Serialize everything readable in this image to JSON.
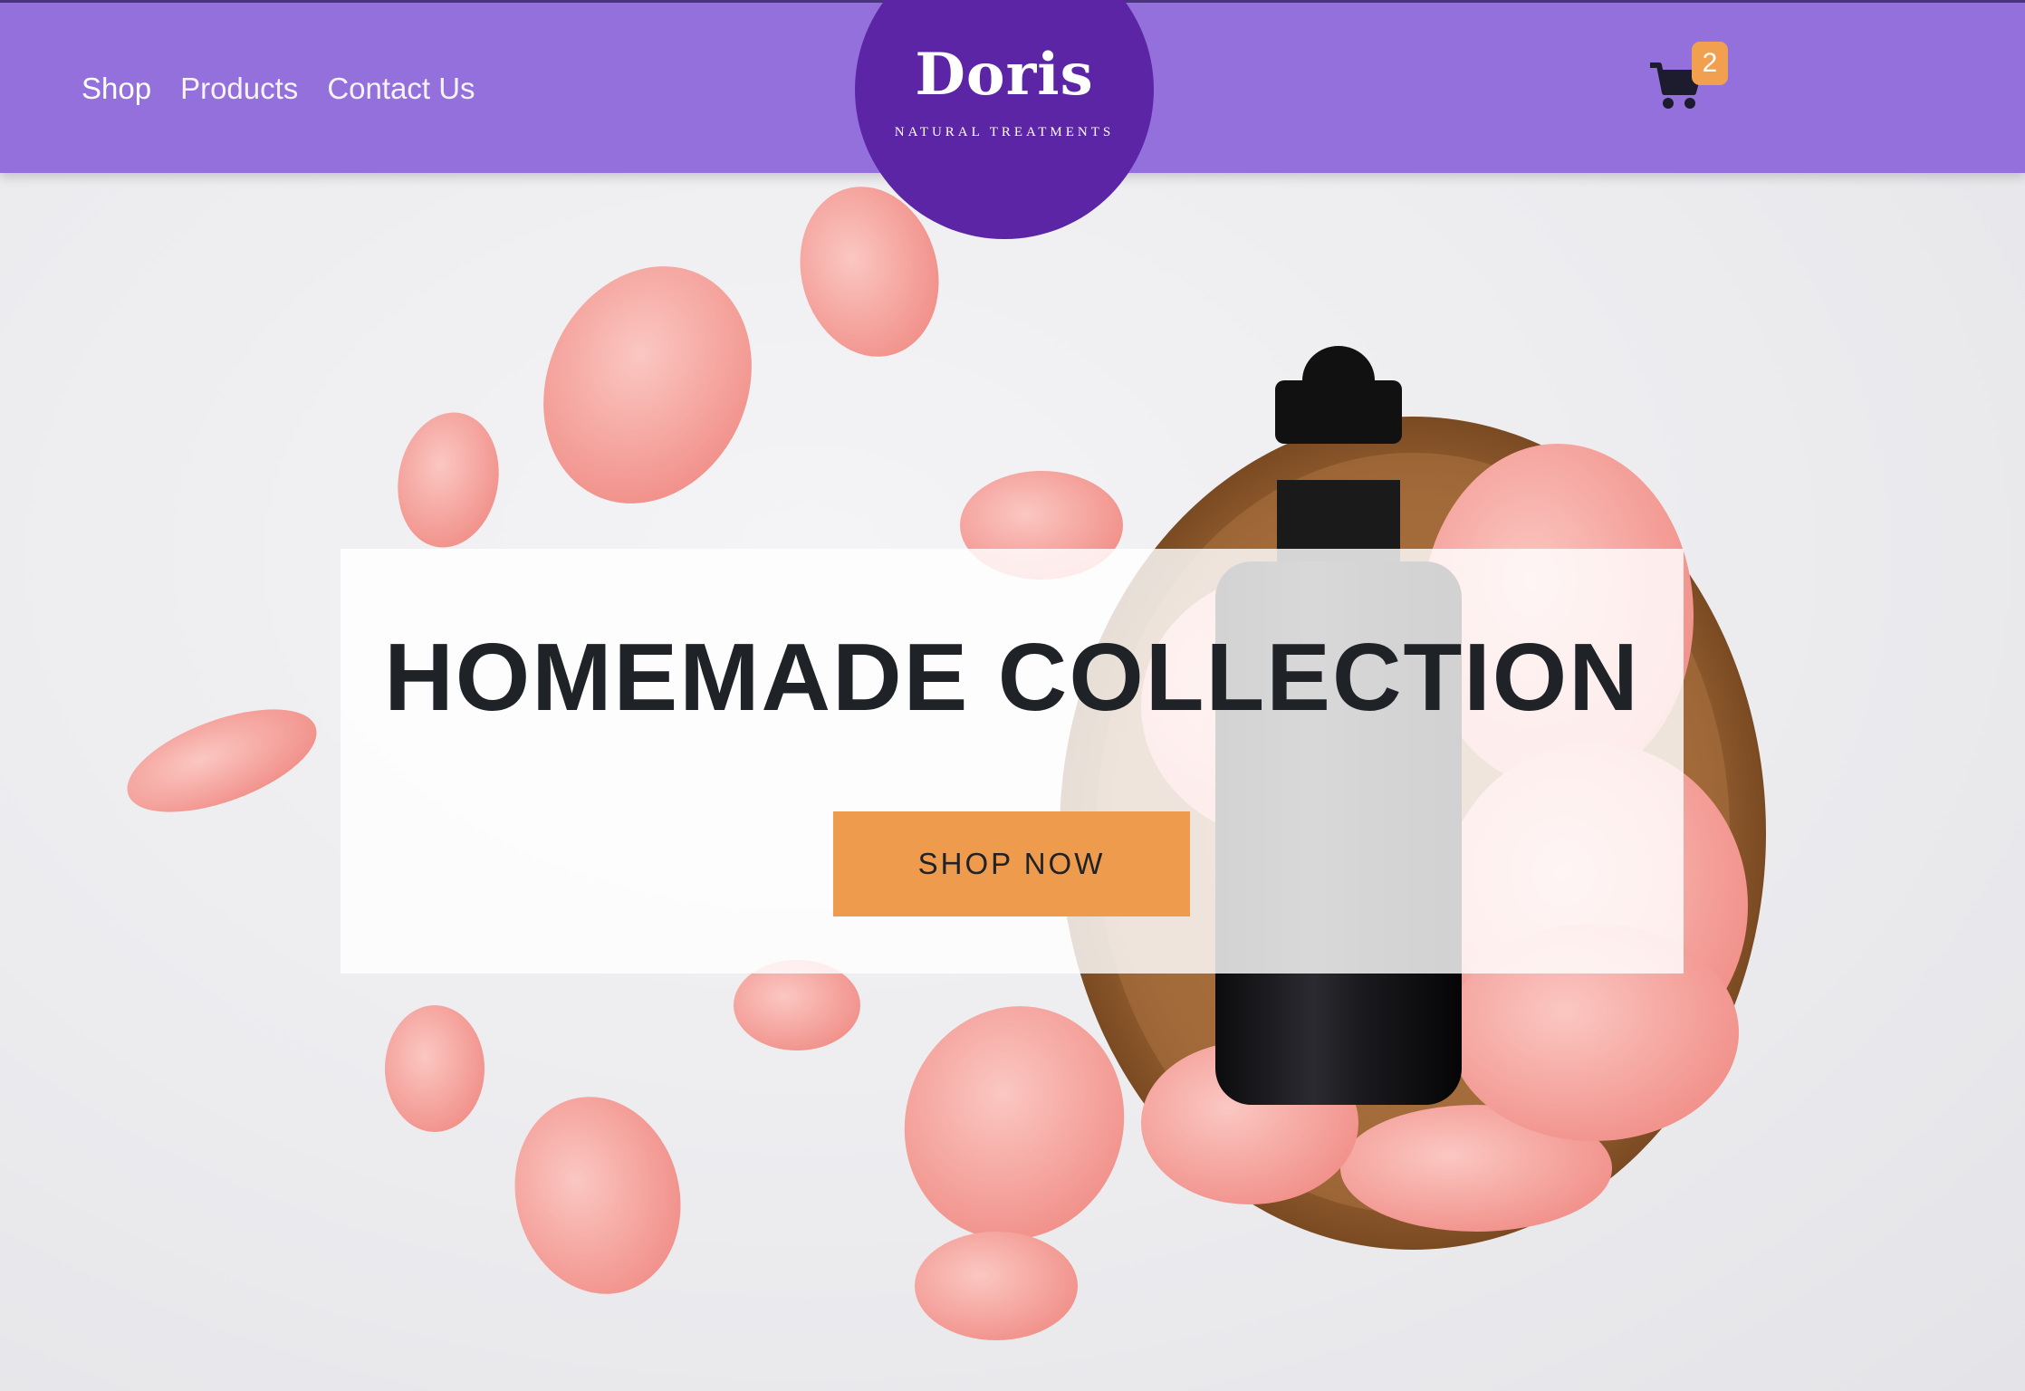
{
  "nav": {
    "links": [
      {
        "label": "Shop"
      },
      {
        "label": "Products"
      },
      {
        "label": "Contact Us"
      }
    ]
  },
  "logo": {
    "name": "Doris",
    "tagline": "NATURAL TREATMENTS"
  },
  "cart": {
    "icon": "shopping-cart-icon",
    "count": "2"
  },
  "hero": {
    "title": "HOMEMADE COLLECTION",
    "cta_label": "SHOP NOW"
  },
  "colors": {
    "navbar": "#9370db",
    "logo_circle": "#5b25a5",
    "accent": "#ef9b4e",
    "text_dark": "#1f2226"
  }
}
